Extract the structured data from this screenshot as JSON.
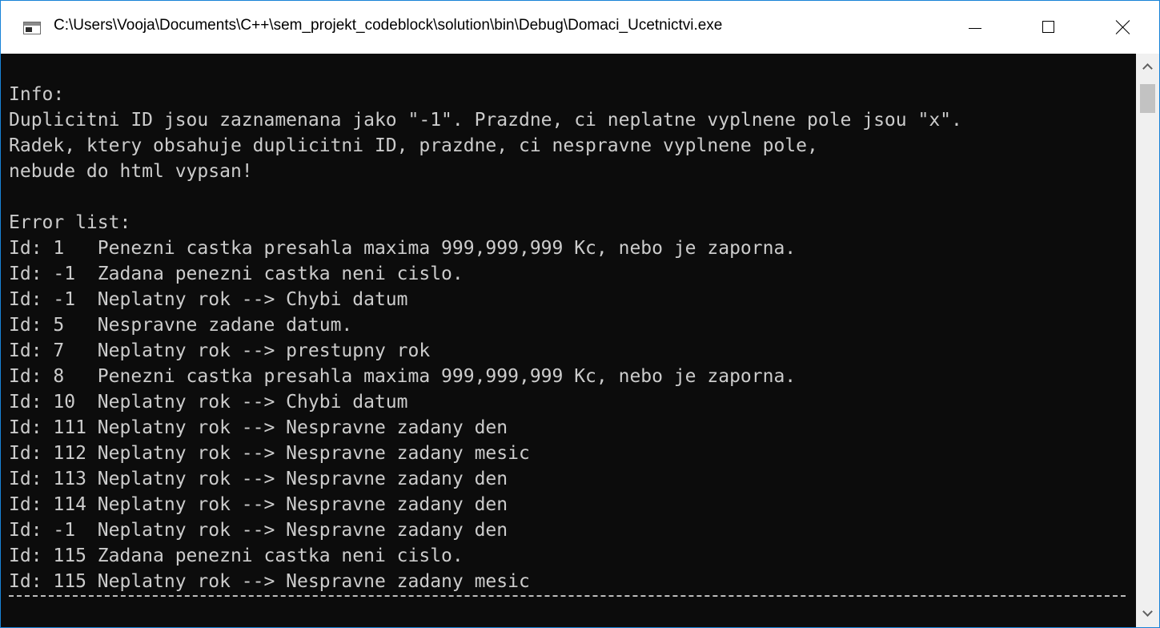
{
  "window": {
    "title": "C:\\Users\\Vooja\\Documents\\C++\\sem_projekt_codeblock\\solution\\bin\\Debug\\Domaci_Ucetnictvi.exe",
    "icon": "console-app-icon",
    "controls": {
      "minimize": "minimize-icon",
      "maximize": "maximize-icon",
      "close": "close-icon"
    }
  },
  "console": {
    "lines": [
      "Info:",
      "Duplicitni ID jsou zaznamenana jako \"-1\". Prazdne, ci neplatne vyplnene pole jsou \"x\".",
      "Radek, ktery obsahuje duplicitni ID, prazdne, ci nespravne vyplnene pole,",
      "nebude do html vypsan!",
      "",
      "Error list:",
      "Id: 1   Penezni castka presahla maxima 999,999,999 Kc, nebo je zaporna.",
      "Id: -1  Zadana penezni castka neni cislo.",
      "Id: -1  Neplatny rok --> Chybi datum",
      "Id: 5   Nespravne zadane datum.",
      "Id: 7   Neplatny rok --> prestupny rok",
      "Id: 8   Penezni castka presahla maxima 999,999,999 Kc, nebo je zaporna.",
      "Id: 10  Neplatny rok --> Chybi datum",
      "Id: 111 Neplatny rok --> Nespravne zadany den",
      "Id: 112 Neplatny rok --> Nespravne zadany mesic",
      "Id: 113 Neplatny rok --> Nespravne zadany den",
      "Id: 114 Neplatny rok --> Nespravne zadany den",
      "Id: -1  Neplatny rok --> Nespravne zadany den",
      "Id: 115 Zadana penezni castka neni cislo.",
      "Id: 115 Neplatny rok --> Nespravne zadany mesic"
    ],
    "text_color": "#cccccc",
    "background_color": "#0c0c0c"
  },
  "scrollbar": {
    "up_icon": "chevron-up-icon",
    "down_icon": "chevron-down-icon"
  }
}
